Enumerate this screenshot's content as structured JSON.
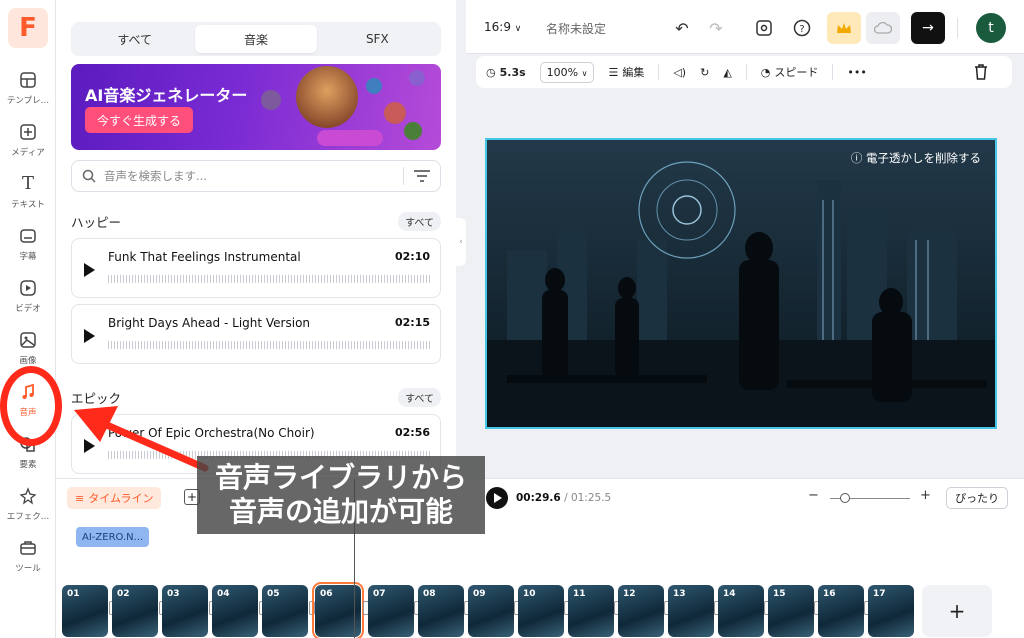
{
  "rail": {
    "logo": "F",
    "items": [
      {
        "label": "テンプレ…",
        "icon": "template-icon"
      },
      {
        "label": "メディア",
        "icon": "media-add-icon"
      },
      {
        "label": "テキスト",
        "icon": "text-icon"
      },
      {
        "label": "字幕",
        "icon": "subtitle-icon"
      },
      {
        "label": "ビデオ",
        "icon": "video-icon"
      },
      {
        "label": "画像",
        "icon": "image-icon"
      },
      {
        "label": "音声",
        "icon": "music-icon"
      },
      {
        "label": "要素",
        "icon": "elements-icon"
      },
      {
        "label": "エフェク…",
        "icon": "effects-icon"
      },
      {
        "label": "ツール",
        "icon": "tools-icon"
      }
    ]
  },
  "panel": {
    "tabs": [
      "すべて",
      "音楽",
      "SFX"
    ],
    "active_tab": "音楽",
    "banner": {
      "title": "AI音楽ジェネレーター",
      "button": "今すぐ生成する"
    },
    "search_placeholder": "音声を検索します...",
    "sections": [
      {
        "title": "ハッピー",
        "all": "すべて",
        "tracks": [
          {
            "name": "Funk That Feelings Instrumental",
            "duration": "02:10"
          },
          {
            "name": "Bright Days Ahead - Light Version",
            "duration": "02:15"
          }
        ]
      },
      {
        "title": "エピック",
        "all": "すべて",
        "tracks": [
          {
            "name": "Power Of Epic Orchestra(No Choir)",
            "duration": "02:56"
          }
        ]
      }
    ]
  },
  "topbar": {
    "ratio": "16:9",
    "project_title": "名称未設定",
    "avatar_letter": "t"
  },
  "edit_toolbar": {
    "duration": "5.3s",
    "zoom": "100%",
    "edit": "編集",
    "speed": "スピード"
  },
  "canvas": {
    "watermark": "電子透かしを削除する"
  },
  "timeline": {
    "tab": "タイムライン",
    "current_time": "00:29.6",
    "total_time": "/ 01:25.5",
    "fit": "ぴったり",
    "audio_clip": "AI-ZERO.N...",
    "clips": [
      "01",
      "02",
      "03",
      "04",
      "05",
      "06",
      "07",
      "08",
      "09",
      "10",
      "11",
      "12",
      "13",
      "14",
      "15",
      "16",
      "17"
    ],
    "selected_clip": "06"
  },
  "annotation": {
    "line1": "音声ライブラリから",
    "line2": "音声の追加が可能"
  },
  "colors": {
    "accent": "#ff5a2b",
    "annotation": "#ff2a1a",
    "selection": "#46c6e6"
  }
}
